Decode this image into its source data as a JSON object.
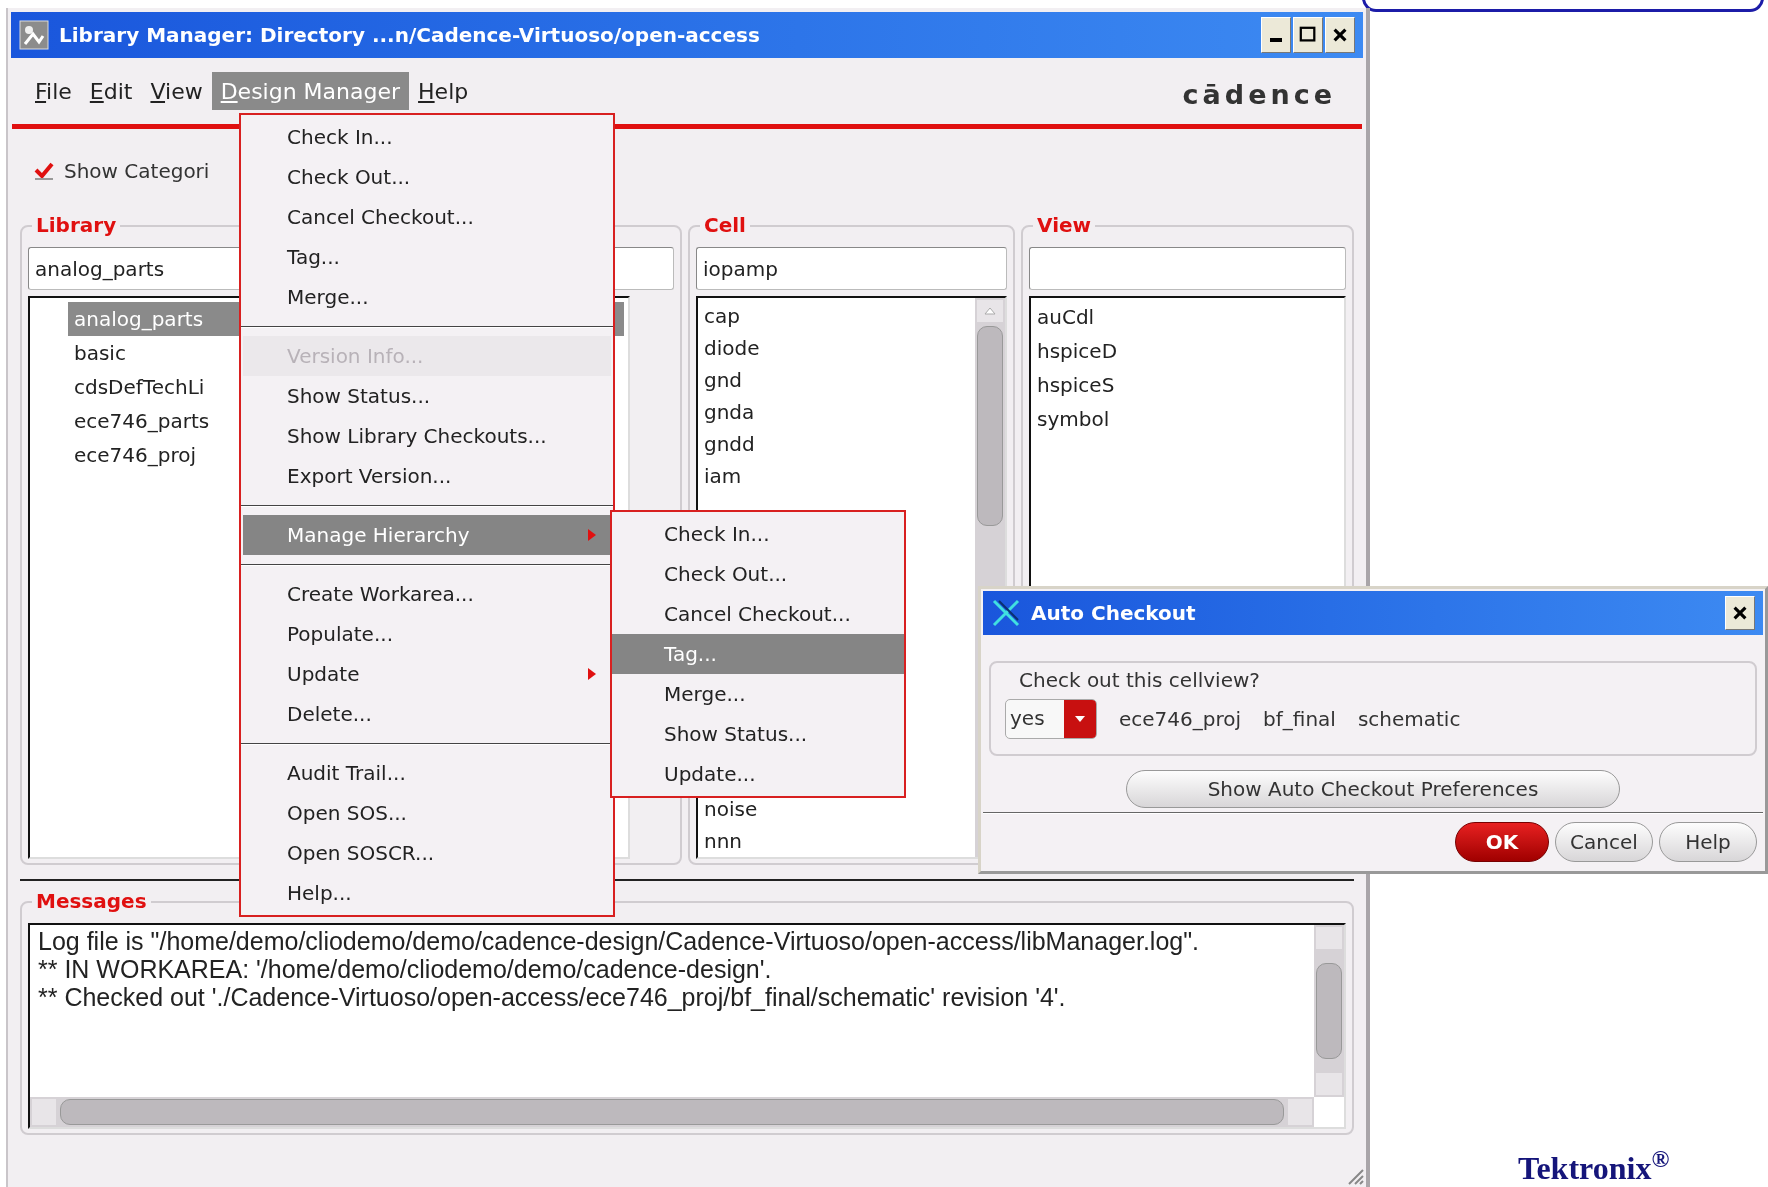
{
  "window": {
    "title": "Library Manager: Directory ...n/Cadence-Virtuoso/open-access"
  },
  "menu_bar": [
    {
      "label": "File",
      "selected": false
    },
    {
      "label": "Edit",
      "selected": false
    },
    {
      "label": "View",
      "selected": false
    },
    {
      "label": "Design Manager",
      "selected": true
    },
    {
      "label": "Help",
      "selected": false
    }
  ],
  "logo": "cādence",
  "show_categories": {
    "label": "Show Categori",
    "checked": true
  },
  "library": {
    "title": "Library",
    "value": "analog_parts",
    "items": [
      {
        "label": "analog_parts",
        "selected": true
      },
      {
        "label": "basic",
        "selected": false
      },
      {
        "label": "cdsDefTechLi",
        "selected": false
      },
      {
        "label": "ece746_parts",
        "selected": false
      },
      {
        "label": "ece746_proj",
        "selected": false
      }
    ]
  },
  "cell": {
    "title": "Cell",
    "value": "iopamp",
    "items": [
      {
        "label": "cap",
        "selected": false
      },
      {
        "label": "diode",
        "selected": false
      },
      {
        "label": "gnd",
        "selected": false
      },
      {
        "label": "gnda",
        "selected": false
      },
      {
        "label": "gndd",
        "selected": false
      },
      {
        "label": "iam",
        "selected": false
      },
      {
        "label": "noise",
        "selected": false
      },
      {
        "label": "nnn",
        "selected": false
      }
    ]
  },
  "view": {
    "title": "View",
    "items": [
      {
        "label": "auCdl",
        "selected": false
      },
      {
        "label": "hspiceD",
        "selected": false
      },
      {
        "label": "hspiceS",
        "selected": false
      },
      {
        "label": "symbol",
        "selected": false
      }
    ]
  },
  "messages": {
    "title": "Messages",
    "lines": [
      "Log file is \"/home/demo/cliodemo/demo/cadence-design/Cadence-Virtuoso/open-access/libManager.log\".",
      "** IN WORKAREA: '/home/demo/cliodemo/demo/cadence-design'.",
      "** Checked out './Cadence-Virtuoso/open-access/ece746_proj/bf_final/schematic' revision '4'."
    ]
  },
  "design_manager_menu": [
    {
      "kind": "item",
      "label": "Check In...",
      "disabled": false,
      "selected": false,
      "submenu": false
    },
    {
      "kind": "item",
      "label": "Check Out...",
      "disabled": false,
      "selected": false,
      "submenu": false
    },
    {
      "kind": "item",
      "label": "Cancel Checkout...",
      "disabled": false,
      "selected": false,
      "submenu": false
    },
    {
      "kind": "item",
      "label": "Tag...",
      "disabled": false,
      "selected": false,
      "submenu": false
    },
    {
      "kind": "item",
      "label": "Merge...",
      "disabled": false,
      "selected": false,
      "submenu": false
    },
    {
      "kind": "separator"
    },
    {
      "kind": "item",
      "label": "Version Info...",
      "disabled": true,
      "selected": false,
      "submenu": false
    },
    {
      "kind": "item",
      "label": "Show Status...",
      "disabled": false,
      "selected": false,
      "submenu": false
    },
    {
      "kind": "item",
      "label": "Show Library Checkouts...",
      "disabled": false,
      "selected": false,
      "submenu": false
    },
    {
      "kind": "item",
      "label": "Export Version...",
      "disabled": false,
      "selected": false,
      "submenu": false
    },
    {
      "kind": "separator"
    },
    {
      "kind": "item",
      "label": "Manage Hierarchy",
      "disabled": false,
      "selected": true,
      "submenu": true
    },
    {
      "kind": "separator"
    },
    {
      "kind": "item",
      "label": "Create Workarea...",
      "disabled": false,
      "selected": false,
      "submenu": false
    },
    {
      "kind": "item",
      "label": "Populate...",
      "disabled": false,
      "selected": false,
      "submenu": false
    },
    {
      "kind": "item",
      "label": "Update",
      "disabled": false,
      "selected": false,
      "submenu": true
    },
    {
      "kind": "item",
      "label": "Delete...",
      "disabled": false,
      "selected": false,
      "submenu": false
    },
    {
      "kind": "separator"
    },
    {
      "kind": "item",
      "label": "Audit Trail...",
      "disabled": false,
      "selected": false,
      "submenu": false
    },
    {
      "kind": "item",
      "label": "Open SOS...",
      "disabled": false,
      "selected": false,
      "submenu": false
    },
    {
      "kind": "item",
      "label": "Open SOSCR...",
      "disabled": false,
      "selected": false,
      "submenu": false
    },
    {
      "kind": "item",
      "label": "Help...",
      "disabled": false,
      "selected": false,
      "submenu": false
    }
  ],
  "hierarchy_submenu": [
    {
      "label": "Check In...",
      "selected": false
    },
    {
      "label": "Check Out...",
      "selected": false
    },
    {
      "label": "Cancel Checkout...",
      "selected": false
    },
    {
      "label": "Tag...",
      "selected": true
    },
    {
      "label": "Merge...",
      "selected": false
    },
    {
      "label": "Show Status...",
      "selected": false
    },
    {
      "label": "Update...",
      "selected": false
    }
  ],
  "auto_checkout_dialog": {
    "title": "Auto Checkout",
    "prompt": "Check out this cellview?",
    "choice": "yes",
    "cellview": [
      "ece746_proj",
      "bf_final",
      "schematic"
    ],
    "preferences_button": "Show Auto Checkout Preferences",
    "buttons": [
      {
        "label": "OK",
        "kind": "default"
      },
      {
        "label": "Cancel",
        "kind": "normal"
      },
      {
        "label": "Help",
        "kind": "normal"
      }
    ]
  },
  "footer_logo": "Tektronix$^{®}$"
}
